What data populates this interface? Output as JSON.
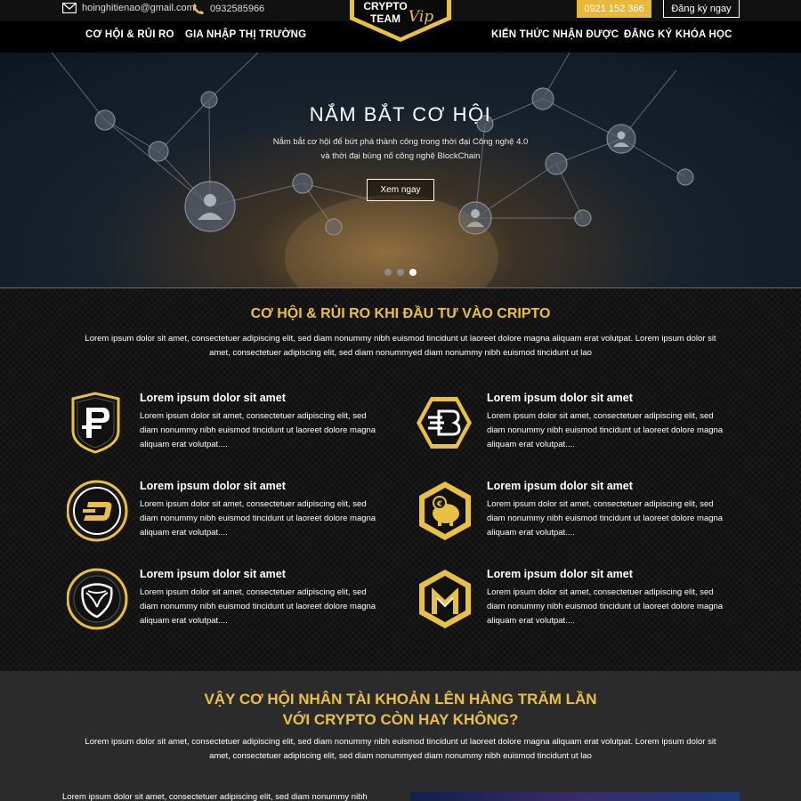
{
  "topbar": {
    "email": "hoinghitienao@gmail.com",
    "phone": "0932585966",
    "hotline": "0921 152 366",
    "register_label": "Đăng ký ngay"
  },
  "logo": {
    "line1": "CRYPTO",
    "line2": "TEAM",
    "script": "Vip"
  },
  "nav": {
    "items": [
      "CƠ HỘI & RỦI RO",
      "GIA NHẬP THỊ TRƯỜNG",
      "KIẾN THỨC NHẬN ĐƯỢC",
      "ĐĂNG KÝ KHÓA HỌC"
    ]
  },
  "hero": {
    "title": "NẮM BẮT CƠ HỘI",
    "subtitle_line1": "Nắm bắt cơ hội để bứt phá thành công trong thời đại Công nghệ 4.0",
    "subtitle_line2": "và thời đại bùng nổ công nghệ BlockChain",
    "button_label": "Xem ngay",
    "slide_count": 3,
    "active_slide": 3
  },
  "section_risk": {
    "title": "CƠ HỘI & RỦI RO KHI ĐẦU TƯ VÀO CRIPTO",
    "desc_line1": "Lorem ipsum dolor sit amet, consectetuer adipiscing elit, sed diam nonummy nibh euismod tincidunt ut laoreet dolore magna aliquam erat volutpat. Lorem ipsum dolor sit",
    "desc_line2": "amet, consectetuer adipiscing elit, sed diam nonummyed diam nonummy nibh euismod tincidunt ut lao",
    "features": [
      {
        "icon": "p-coin-shield-icon",
        "title": "Lorem ipsum dolor sit amet",
        "line1": "Lorem ipsum dolor sit amet, consectetuer adipiscing elit, sed",
        "line2": "diam nonummy nibh euismod tincidunt ut laoreet dolore magna",
        "line3": "aliquam erat volutpat...."
      },
      {
        "icon": "b-coin-hexagon-icon",
        "title": "Lorem ipsum dolor sit amet",
        "line1": "Lorem ipsum dolor sit amet, consectetuer adipiscing elit, sed",
        "line2": "diam nonummy nibh euismod tincidunt ut laoreet dolore magna",
        "line3": "aliquam erat volutpat...."
      },
      {
        "icon": "dash-coin-circle-icon",
        "title": "Lorem ipsum dolor sit amet",
        "line1": "Lorem ipsum dolor sit amet, consectetuer adipiscing elit, sed",
        "line2": "diam nonummy nibh euismod tincidunt ut laoreet dolore magna",
        "line3": "aliquam erat volutpat...."
      },
      {
        "icon": "piggy-bank-hexagon-icon",
        "title": "Lorem ipsum dolor sit amet",
        "line1": "Lorem ipsum dolor sit amet, consectetuer adipiscing elit, sed",
        "line2": "diam nonummy nibh euismod tincidunt ut laoreet dolore magna",
        "line3": "aliquam erat volutpat...."
      },
      {
        "icon": "nem-coin-circle-icon",
        "title": "Lorem ipsum dolor sit amet",
        "line1": "Lorem ipsum dolor sit amet, consectetuer adipiscing elit, sed",
        "line2": "diam nonummy nibh euismod tincidunt ut laoreet dolore magna",
        "line3": "aliquam erat volutpat...."
      },
      {
        "icon": "m-coin-hexagon-icon",
        "title": "Lorem ipsum dolor sit amet",
        "line1": "Lorem ipsum dolor sit amet, consectetuer adipiscing elit, sed",
        "line2": "diam nonummy nibh euismod tincidunt ut laoreet dolore magna",
        "line3": "aliquam erat volutpat...."
      }
    ]
  },
  "section_opportunity": {
    "title_line1": "VẬY CƠ HỘI NHÂN TÀI KHOẢN LÊN HÀNG TRĂM LẦN",
    "title_line2": "VỚI CRYPTO CÒN HAY KHÔNG?",
    "desc_line1": "Lorem ipsum dolor sit amet, consectetuer adipiscing elit, sed diam nonummy nibh euismod tincidunt ut laoreet dolore magna aliquam erat volutpat. Lorem ipsum dolor sit",
    "desc_line2": "amet, consectetuer adipiscing elit, sed diam nonummyed diam nonummy nibh euismod tincidunt ut lao",
    "para_start": "Lorem ipsum dolor sit amet, consectetuer adipiscing elit, sed diam nonummy nibh"
  },
  "colors": {
    "gold": "#e9c046",
    "hotline_bg": "#e8b83a",
    "section2_bg": "#101010",
    "section3_bg": "#2b2b2b"
  }
}
